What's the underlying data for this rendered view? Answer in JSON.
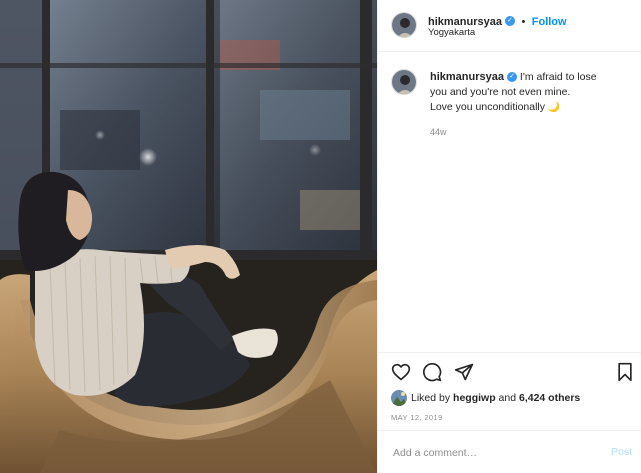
{
  "post": {
    "username": "hikmanursyaa",
    "follow_separator": "•",
    "follow_label": "Follow",
    "location": "Yogyakarta",
    "caption": {
      "line1": "I'm afraid to lose",
      "line2": "you and you're not even mine.",
      "line3": "Love you unconditionally",
      "emoji": "🌙"
    },
    "time_ago": "44w",
    "likes": {
      "prefix": "Liked by ",
      "liker": "heggiwp",
      "joiner": " and ",
      "count_text": "6,424 others"
    },
    "date": "MAY 12, 2019"
  },
  "comment_box": {
    "placeholder": "Add a comment…",
    "post_label": "Post"
  },
  "icons": {
    "verified": "verified-badge-icon",
    "like": "heart-icon",
    "comment": "comment-bubble-icon",
    "share": "paper-plane-icon",
    "save": "bookmark-icon"
  },
  "colors": {
    "link_blue": "#0095f6",
    "verified_blue": "#3897f0",
    "muted_gray": "#8e8e8e",
    "post_disabled": "#b2dffc"
  }
}
